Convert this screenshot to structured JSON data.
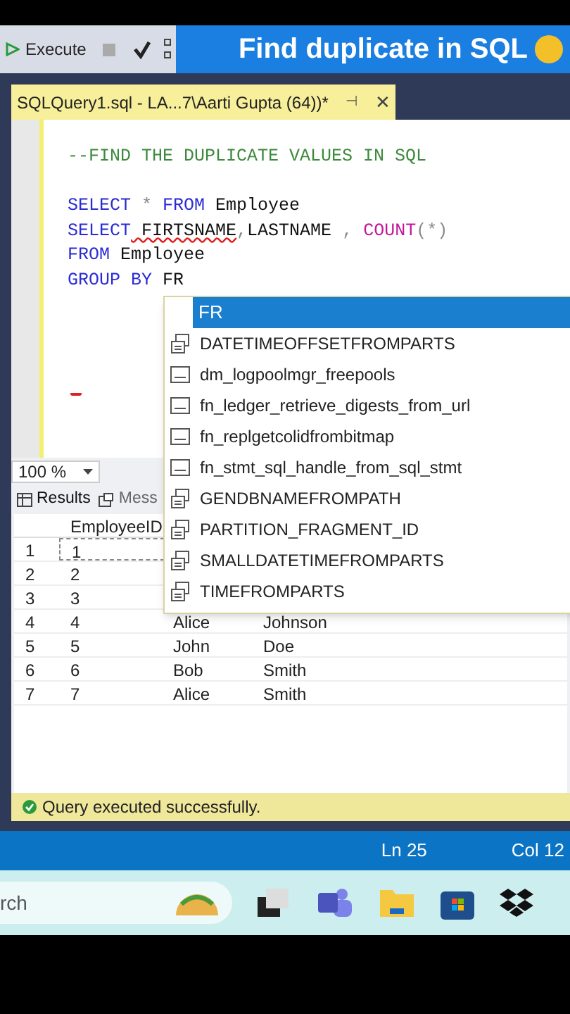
{
  "banner": {
    "title": "Find duplicate in SQL"
  },
  "toolbar": {
    "execute": "Execute"
  },
  "tab": {
    "title": "SQLQuery1.sql - LA...7\\Aarti Gupta (64))*",
    "pin": "⊣",
    "close": "✕"
  },
  "editor": {
    "blocks": [
      [
        [
          {
            "kind": "comment",
            "text": "--FIND THE DUPLICATE VALUES IN SQL"
          }
        ]
      ],
      [
        [
          {
            "kind": "keyword",
            "text": "SELECT"
          },
          {
            "kind": "operator",
            "text": " * "
          },
          {
            "kind": "keyword",
            "text": "FROM"
          },
          {
            "kind": "plain",
            "text": " Employee"
          }
        ],
        [
          {
            "kind": "keyword",
            "text": "SELECT"
          },
          {
            "kind": "error",
            "text": " FIRTSNAME"
          },
          {
            "kind": "operator",
            "text": ","
          },
          {
            "kind": "plain",
            "text": "LASTNAME "
          },
          {
            "kind": "operator",
            "text": ", "
          },
          {
            "kind": "function",
            "text": "COUNT"
          },
          {
            "kind": "operator",
            "text": "(*)"
          }
        ],
        [
          {
            "kind": "keyword",
            "text": "FROM"
          },
          {
            "kind": "plain",
            "text": " Employee"
          }
        ],
        [
          {
            "kind": "keyword",
            "text": "GROUP BY"
          },
          {
            "kind": "plain",
            "text": " FR"
          }
        ]
      ]
    ]
  },
  "autocomplete": {
    "input": "FR",
    "items": [
      {
        "kind": "scalar",
        "label": "DATETIMEOFFSETFROMPARTS"
      },
      {
        "kind": "table",
        "label": "dm_logpoolmgr_freepools"
      },
      {
        "kind": "table",
        "label": "fn_ledger_retrieve_digests_from_url"
      },
      {
        "kind": "table",
        "label": "fn_replgetcolidfrombitmap"
      },
      {
        "kind": "table",
        "label": "fn_stmt_sql_handle_from_sql_stmt"
      },
      {
        "kind": "scalar",
        "label": "GENDBNAMEFROMPATH"
      },
      {
        "kind": "scalar",
        "label": "PARTITION_FRAGMENT_ID"
      },
      {
        "kind": "scalar",
        "label": "SMALLDATETIMEFROMPARTS"
      },
      {
        "kind": "scalar",
        "label": "TIMEFROMPARTS"
      }
    ]
  },
  "zoom": "100 %",
  "result_tabs": [
    {
      "label": "Results",
      "selected": true
    },
    {
      "label": "Mess",
      "selected": false
    }
  ],
  "grid": {
    "columns": [
      "EmployeeID"
    ],
    "rows": [
      {
        "number": "1",
        "cells": [
          "1"
        ]
      },
      {
        "number": "2",
        "cells": [
          "2"
        ]
      },
      {
        "number": "3",
        "cells": [
          "3"
        ]
      },
      {
        "number": "4",
        "cells": [
          "4",
          "Alice",
          "Johnson"
        ]
      },
      {
        "number": "5",
        "cells": [
          "5",
          "John",
          "Doe"
        ]
      },
      {
        "number": "6",
        "cells": [
          "6",
          "Bob",
          "Smith"
        ]
      },
      {
        "number": "7",
        "cells": [
          "7",
          "Alice",
          "Smith"
        ]
      }
    ]
  },
  "query_status": "Query executed successfully.",
  "status_bar": {
    "line": "Ln 25",
    "column": "Col 12"
  },
  "taskbar": {
    "search": "rch"
  }
}
